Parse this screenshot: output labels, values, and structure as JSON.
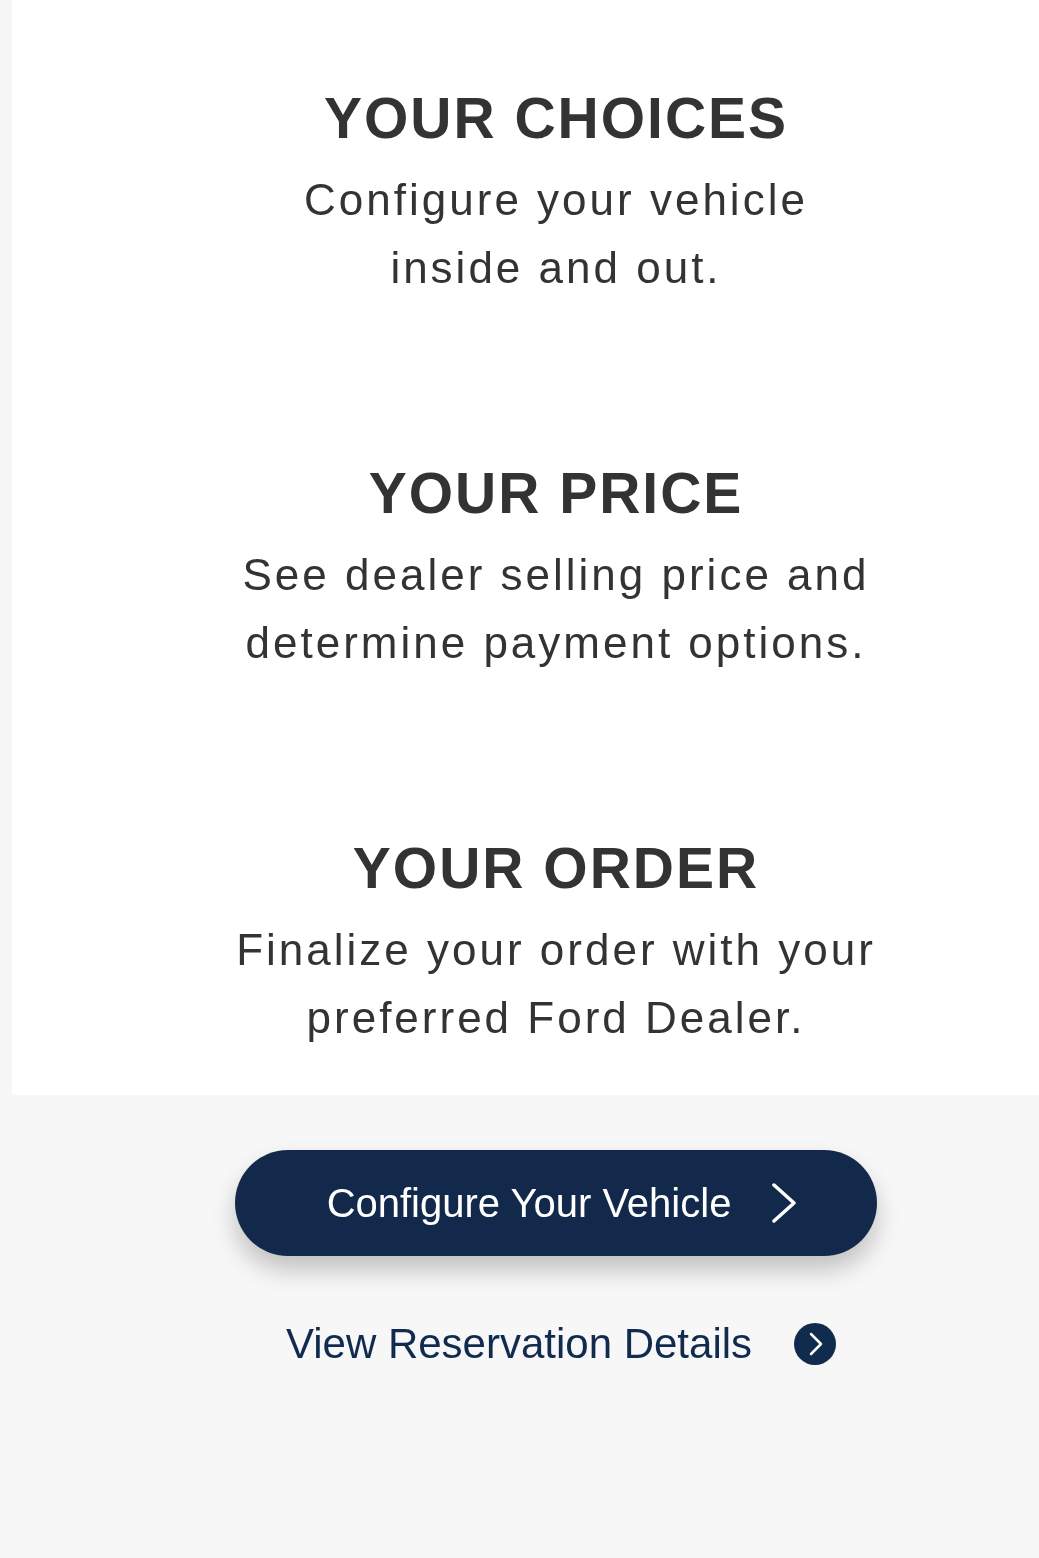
{
  "sections": [
    {
      "title": "YOUR CHOICES",
      "description": "Configure your vehicle\ninside and out."
    },
    {
      "title": "YOUR PRICE",
      "description": "See dealer selling price and\ndetermine payment options."
    },
    {
      "title": "YOUR ORDER",
      "description": "Finalize your order with your\npreferred Ford Dealer."
    }
  ],
  "primary_button": {
    "label": "Configure Your Vehicle"
  },
  "link": {
    "label": "View Reservation Details"
  }
}
